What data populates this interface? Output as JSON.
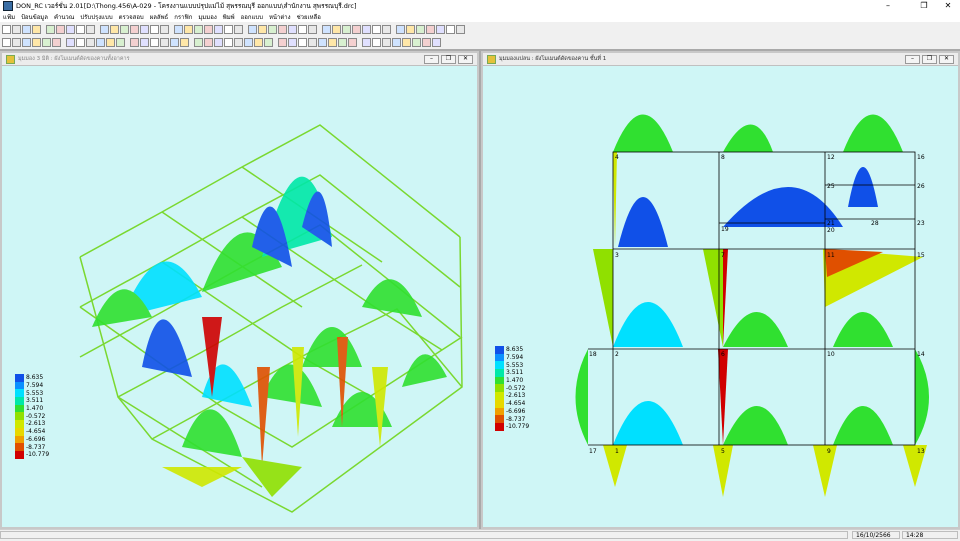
{
  "window": {
    "title": "DON_RC เวอร์ชั่น 2.01[D:\\Thong.456\\A-029 - โครงงานแบบปรุปแม่ไม้ สุพรรณบุรี ออกแบบ\\สำนักงาน สุพรรณบุรี.drc]"
  },
  "window_controls": {
    "minimize": "–",
    "restore": "❐",
    "close": "✕"
  },
  "menu": [
    "แฟ้ม",
    "ป้อนข้อมูล",
    "คำนวณ",
    "ปรับปรุงแบบ",
    "ตรวจสอบ",
    "ผลลัพธ์",
    "กราฟิก",
    "มุมมอง",
    "พิมพ์",
    "ออกแบบ",
    "หน้าต่าง",
    "ช่วยเหลือ"
  ],
  "left_window": {
    "title": "มุมมอง 3 มิติ : ผังโมเมนต์ดัดของคานทั้งอาคาร",
    "buttons": [
      "–",
      "❐",
      "✕"
    ]
  },
  "right_window": {
    "title": "มุมมองแปลน : ผังโมเมนต์ดัดของคาน ชั้นที่ 1",
    "buttons": [
      "–",
      "❐",
      "✕"
    ]
  },
  "legend": {
    "values": [
      "8.635",
      "7.594",
      "5.553",
      "3.511",
      "1.470",
      "-0.572",
      "-2.613",
      "-4.654",
      "-6.696",
      "-8.737",
      "-10.779"
    ],
    "colors": [
      "#1050e8",
      "#0a90ff",
      "#00e0ff",
      "#00e8a8",
      "#30e030",
      "#90e000",
      "#d0e800",
      "#e8d800",
      "#f0a000",
      "#e05000",
      "#d00000"
    ]
  },
  "plan_nodes": [
    "4",
    "8",
    "12",
    "16",
    "25",
    "26",
    "19",
    "21",
    "20",
    "28",
    "23",
    "3",
    "7",
    "11",
    "15",
    "18",
    "2",
    "6",
    "10",
    "14",
    "17",
    "1",
    "5",
    "9",
    "13"
  ],
  "status": {
    "date": "16/10/2566",
    "time": "14:28"
  }
}
